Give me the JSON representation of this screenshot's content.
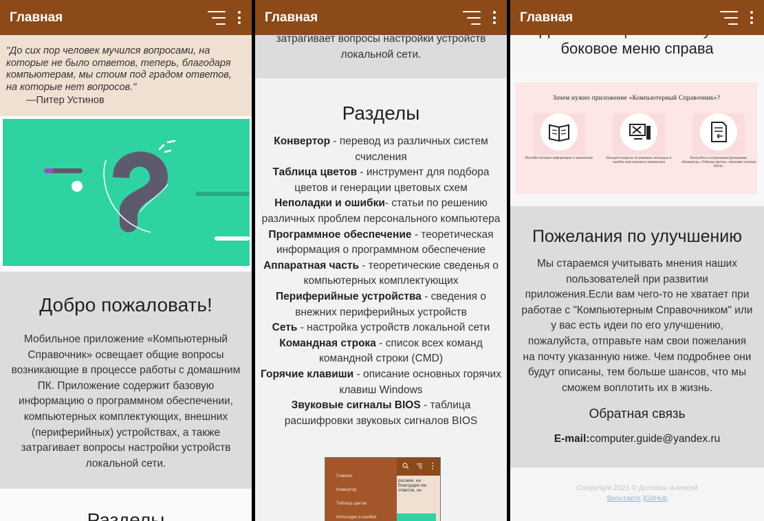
{
  "appbar": {
    "title": "Главная",
    "sort_icon": "sort-icon",
    "menu_icon": "more-vert-icon"
  },
  "colors": {
    "appbar": "#8b4a18",
    "quote_bg": "#f0e0d2",
    "hero_teal": "#2fd3a2",
    "gray_band": "#dcdcdf"
  },
  "screen1": {
    "quote": "\"До сих пор человек мучился вопросами, на которые не было ответов, теперь, благодаря компьютерам, мы стоим под градом ответов, на которые нет вопросов.\"",
    "quote_author": "—Питер Устинов",
    "welcome_title": "Добро пожаловать!",
    "welcome_text": "Мобильное приложение «Компьютерный Справочник» освещает общие вопросы возникающие в процессе работы с домашним ПК. Приложение содержит базовую информацию о программном обеспечении, компьютерных комплектующих, внешних (периферийных) устройствах, а также затрагивает вопросы настройки устройств локальной сети.",
    "next_title": "Разделы"
  },
  "screen2": {
    "top_text": "затрагивает вопросы настройки устройств локальной сети.",
    "sections_title": "Разделы",
    "sections": [
      {
        "name": "Конвертор",
        "desc": " - перевод из различных систем счисления"
      },
      {
        "name": "Таблица цветов",
        "desc": " - инструмент для подбора цветов и генерации цветовых схем"
      },
      {
        "name": "Неполадки и ошибки",
        "desc": "- статьи по решению различных проблем персонального компьютера"
      },
      {
        "name": "Программное обеспечение",
        "desc": " - теоретическая информация о программном обеспечение"
      },
      {
        "name": "Аппаратная часть",
        "desc": " - теоретические сведенья о компьютерных комплектующих"
      },
      {
        "name": "Периферийные устройства",
        "desc": " - сведения о внежних периферийных устройств"
      },
      {
        "name": "Сеть",
        "desc": " - настройка устройств локальной сети"
      },
      {
        "name": "Командная строка",
        "desc": " - список всех команд командной строки (CMD)"
      },
      {
        "name": "Горячие клавиши",
        "desc": " - описание основных горячих клавиш Windows"
      },
      {
        "name": "Звуковые сигналы BIOS",
        "desc": " - таблица расшифровки звуковых сигналов BIOS"
      }
    ],
    "thumb": {
      "menu": [
        "Главная",
        "Конвертор",
        "Таблица цветов",
        "Неполадки и ошибки"
      ],
      "text": "росами, на благодаря ом ответов, не"
    }
  },
  "screen3": {
    "top_line1": "Для навигации используйте",
    "top_line2": "боковое меню справа",
    "banner_title": "Зачем нужно приложение «Компьютерный Справочник»?",
    "banner_captions": [
      "Изучайте базовую информацию о компьютере",
      "Находите вопросы по решению неполадок и ошибок персонального компьютера",
      "Пользуйтесь встроенными функциями: «Конвертор» «Таблица цветов» «Звуковые сигналы BIOS»"
    ],
    "wishes_title": "Пожелания по улучшению",
    "wishes_text": "Мы стараемся учитывать мнения наших пользователей при развитии приложения.Если вам чего-то не хватает при работае с \"Компьютерным Справочником\" или у вас есть идеи по его улучшению, пожалуйста, отправьте нам свои пожелания на почту указанную ниже. Чем подробнее они будут описаны, тем больше шансов, что мы сможем воплотить их в жизнь.",
    "feedback_title": "Обратная связь",
    "email_label": "E-mail:",
    "email": "computer.guide@yandex.ru",
    "copyright": "Coopyright 2021 © Долобан Алексей",
    "link_vk": "Вконтакте",
    "link_sep": " |",
    "link_github": "GitHub"
  }
}
